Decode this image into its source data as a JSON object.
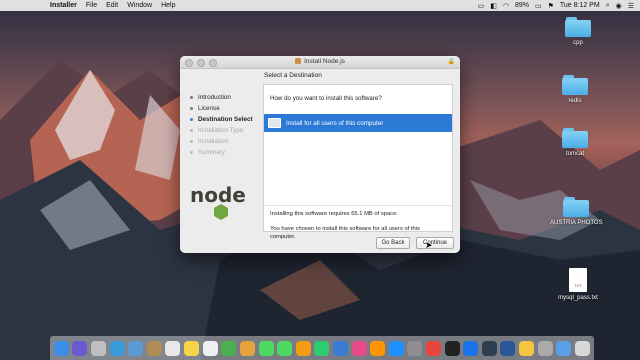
{
  "menubar": {
    "apple": "",
    "app": "Installer",
    "items": [
      "File",
      "Edit",
      "Window",
      "Help"
    ],
    "battery": "89%",
    "time": "Tue 8:12 PM"
  },
  "desktop_icons": [
    {
      "label": "cpp",
      "kind": "folder"
    },
    {
      "label": "redis",
      "kind": "folder"
    },
    {
      "label": "tomcat",
      "kind": "folder"
    },
    {
      "label": "AUSTRIA PHOTOS",
      "kind": "folder"
    },
    {
      "label": "mysql_pass.txt",
      "kind": "txt",
      "file_tag": "TXT"
    }
  ],
  "window": {
    "title": "Install Node.js",
    "pane_title": "Select a Destination",
    "steps": [
      {
        "label": "Introduction",
        "state": "done"
      },
      {
        "label": "License",
        "state": "done"
      },
      {
        "label": "Destination Select",
        "state": "active"
      },
      {
        "label": "Installation Type",
        "state": "pending"
      },
      {
        "label": "Installation",
        "state": "pending"
      },
      {
        "label": "Summary",
        "state": "pending"
      }
    ],
    "question": "How do you want to install this software?",
    "option_selected": "Install for all users of this computer",
    "space_note": "Installing this software requires 65.1 MB of space.",
    "chosen_note": "You have chosen to install this software for all users of this computer.",
    "back_label": "Go Back",
    "continue_label": "Continue",
    "logo_text": "node"
  },
  "dock": {
    "icons": [
      "finder-icon",
      "siri-icon",
      "launchpad-icon",
      "safari-icon",
      "mail-icon",
      "contacts-icon",
      "calendar-icon",
      "notes-icon",
      "reminders-icon",
      "maps-icon",
      "photos-icon",
      "messages-icon",
      "facetime-icon",
      "pages-icon",
      "numbers-icon",
      "keynote-icon",
      "itunes-icon",
      "ibooks-icon",
      "app-store-icon",
      "system-preferences-icon",
      "chrome-icon",
      "terminal-icon",
      "visual-studio-code-icon",
      "launcher-icon",
      "word-icon",
      "folder-icon",
      "utility-icon",
      "downloads-icon",
      "trash-icon"
    ],
    "colors": [
      "#3b8ee8",
      "#6a5acd",
      "#c0c0c0",
      "#3a9ad9",
      "#5b9bd5",
      "#b08d57",
      "#e8e8e8",
      "#f5d547",
      "#f0f0f0",
      "#4caf50",
      "#e6a23c",
      "#4cd964",
      "#4cd964",
      "#f39c12",
      "#2ecc71",
      "#3a7bd5",
      "#e84c88",
      "#ff9500",
      "#1e90ff",
      "#8e8e93",
      "#e8453c",
      "#222222",
      "#1a73e8",
      "#2c3e50",
      "#2b579a",
      "#f5c542",
      "#aaaaaa",
      "#5aa0e6",
      "#d8d8d8"
    ]
  }
}
